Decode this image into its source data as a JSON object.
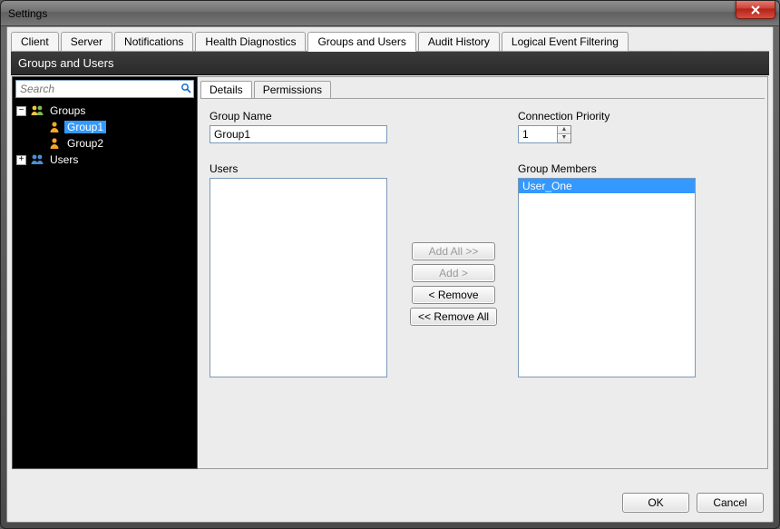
{
  "window": {
    "title": "Settings"
  },
  "main_tabs": {
    "items": [
      "Client",
      "Server",
      "Notifications",
      "Health Diagnostics",
      "Groups and Users",
      "Audit History",
      "Logical Event Filtering"
    ],
    "active": "Groups and Users"
  },
  "panel": {
    "header": "Groups and Users"
  },
  "search": {
    "placeholder": "Search"
  },
  "tree": {
    "groups_label": "Groups",
    "groups_expanded": true,
    "group_items": [
      "Group1",
      "Group2"
    ],
    "selected_group": "Group1",
    "users_label": "Users",
    "users_expanded": false
  },
  "sub_tabs": {
    "items": [
      "Details",
      "Permissions"
    ],
    "active": "Details"
  },
  "details": {
    "group_name_label": "Group Name",
    "group_name_value": "Group1",
    "connection_priority_label": "Connection Priority",
    "connection_priority_value": "1",
    "users_label": "Users",
    "users_list": [],
    "members_label": "Group Members",
    "members_list": [
      "User_One"
    ],
    "selected_member": "User_One",
    "buttons": {
      "add_all": "Add All >>",
      "add": "Add >",
      "remove": "< Remove",
      "remove_all": "<< Remove All"
    }
  },
  "footer": {
    "ok": "OK",
    "cancel": "Cancel"
  }
}
